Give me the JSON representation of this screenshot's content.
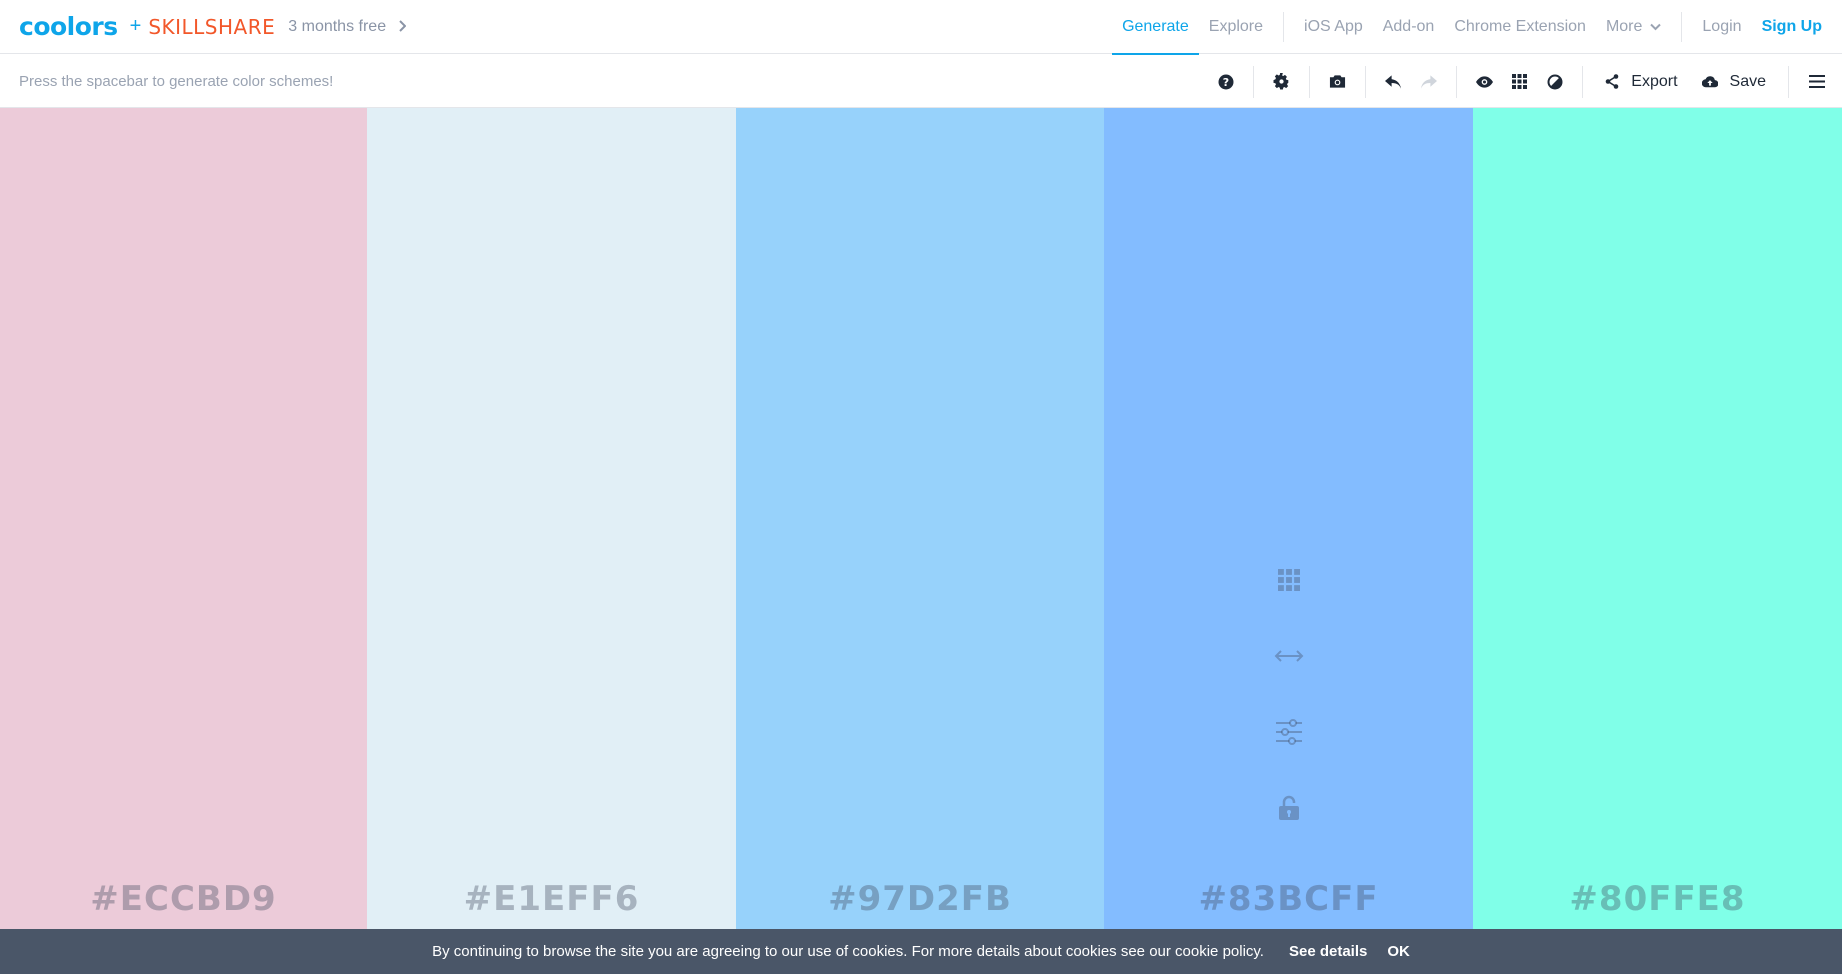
{
  "navbar": {
    "logo_text": "coolors",
    "plus": "+",
    "partner_text": "SKILLSHARE",
    "promo": "3 months free",
    "links": {
      "generate": "Generate",
      "explore": "Explore",
      "ios_app": "iOS App",
      "add_on": "Add-on",
      "chrome_extension": "Chrome Extension",
      "more": "More",
      "login": "Login",
      "sign_up": "Sign Up"
    },
    "active_link": "Generate",
    "accent_color": "#0ea5e9",
    "partner_color": "#f2572a"
  },
  "toolbar": {
    "hint": "Press the spacebar to generate color schemes!",
    "icons": [
      "help-icon",
      "settings-icon",
      "camera-icon",
      "undo-icon",
      "redo-icon",
      "view-icon",
      "grid-icon",
      "contrast-icon",
      "share-icon",
      "cloud-upload-icon",
      "menu-icon"
    ],
    "export_label": "Export",
    "save_label": "Save"
  },
  "palette": {
    "swatches": [
      {
        "hex": "#ECCBD9",
        "color": "#ECCBD9"
      },
      {
        "hex": "#E1EFF6",
        "color": "#E1EFF6"
      },
      {
        "hex": "#97D2FB",
        "color": "#97D2FB"
      },
      {
        "hex": "#83BCFF",
        "color": "#83BCFF"
      },
      {
        "hex": "#80FFE8",
        "color": "#80FFE8"
      }
    ],
    "hovered_swatch_tools": [
      "shades-grid-icon",
      "drag-arrows-icon",
      "adjust-sliders-icon",
      "unlock-icon"
    ]
  },
  "cookie_bar": {
    "message": "By continuing to browse the site you are agreeing to our use of cookies. For more details about cookies see our cookie policy.",
    "details_label": "See details",
    "ok_label": "OK"
  }
}
